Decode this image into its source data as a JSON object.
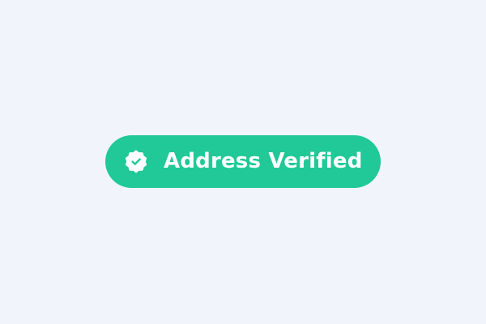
{
  "badge": {
    "label": "Address Verified",
    "icon": "verified-badge-check-icon",
    "status": "verified"
  },
  "colors": {
    "page_background": "#f1f4fb",
    "badge_background": "#20c997",
    "badge_text": "#ffffff"
  }
}
